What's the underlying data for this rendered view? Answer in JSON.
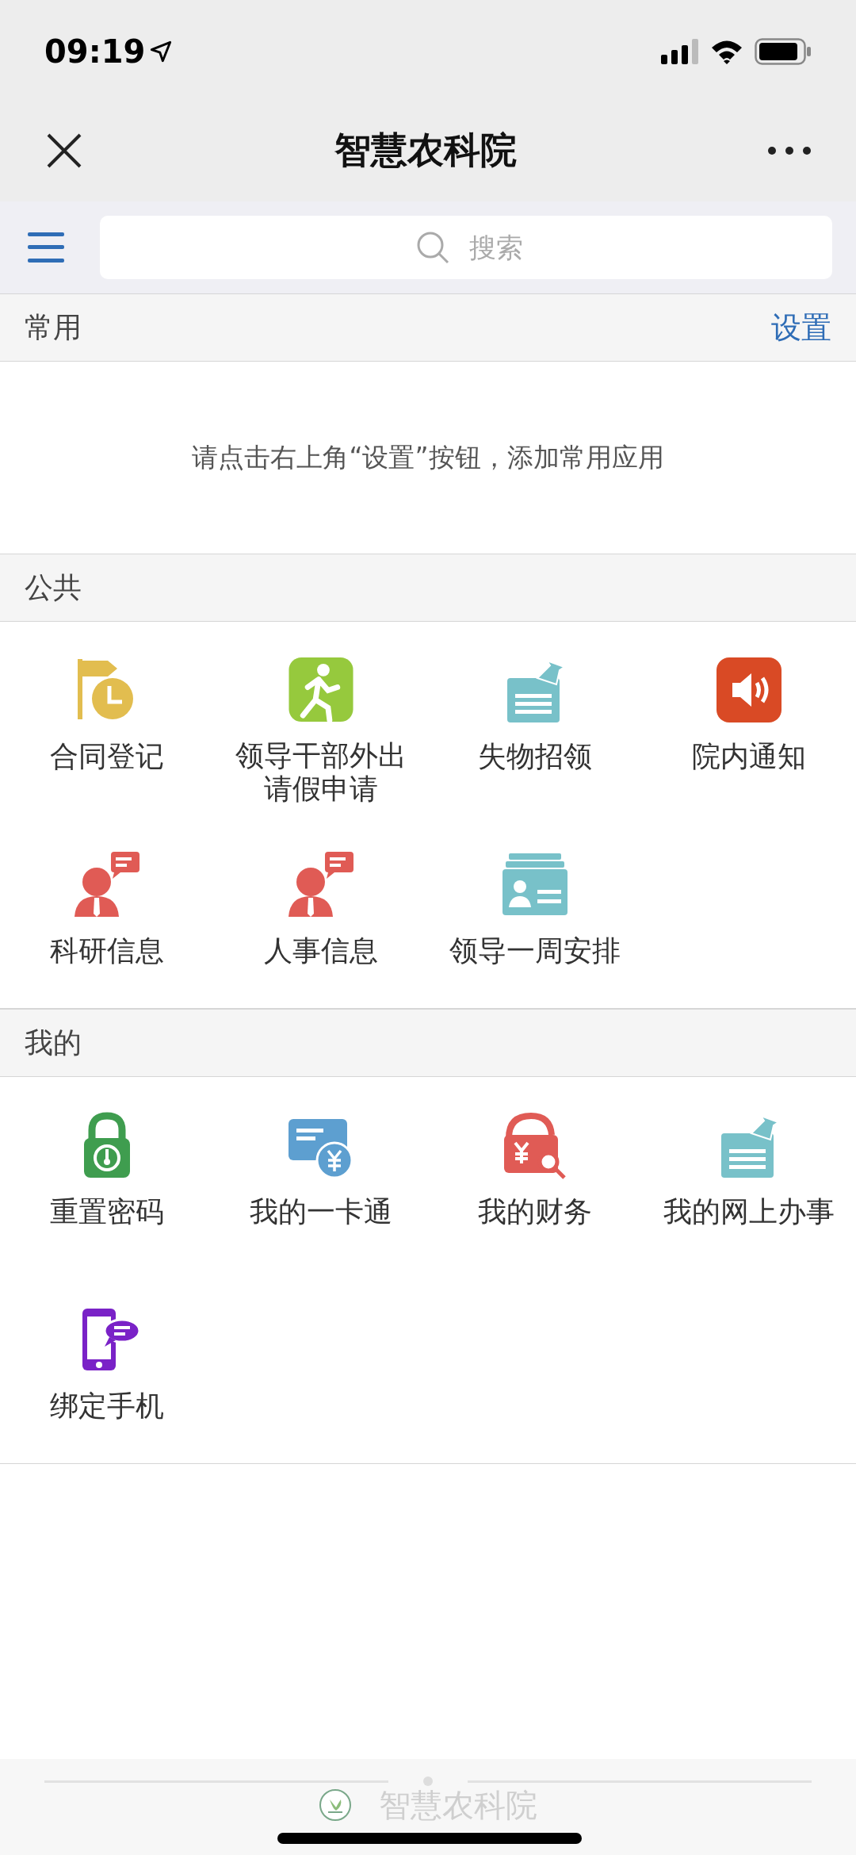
{
  "status_bar": {
    "time": "09:19"
  },
  "nav": {
    "title": "智慧农科院"
  },
  "search": {
    "placeholder": "搜索"
  },
  "sections": [
    {
      "kind": "empty",
      "title": "常用",
      "action": "设置",
      "message": "请点击右上角“设置”按钮，添加常用应用"
    },
    {
      "kind": "grid",
      "title": "公共",
      "items": [
        {
          "label": "合同登记"
        },
        {
          "label": "领导干部外出请假申请"
        },
        {
          "label": "失物招领"
        },
        {
          "label": "院内通知"
        },
        {
          "label": "科研信息"
        },
        {
          "label": "人事信息"
        },
        {
          "label": "领导一周安排"
        }
      ]
    },
    {
      "kind": "grid",
      "title": "我的",
      "items": [
        {
          "label": "重置密码"
        },
        {
          "label": "我的一卡通"
        },
        {
          "label": "我的财务"
        },
        {
          "label": "我的网上办事"
        },
        {
          "label": "绑定手机"
        }
      ]
    }
  ],
  "footer": {
    "brand": "智慧农科院"
  }
}
